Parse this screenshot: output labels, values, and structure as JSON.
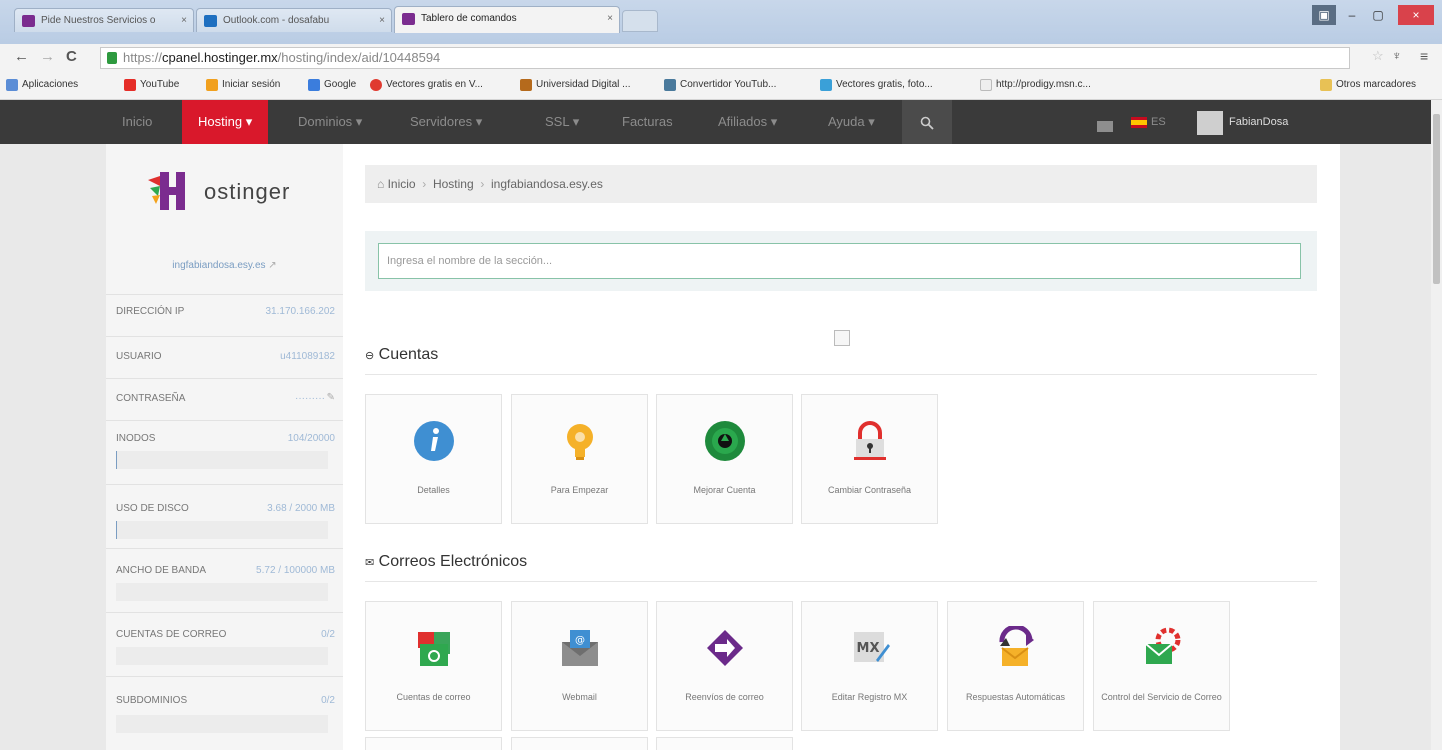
{
  "browser": {
    "tabs": [
      {
        "label": "Pide Nuestros Servicios o",
        "active": false
      },
      {
        "label": "Outlook.com - dosafabu",
        "active": false
      },
      {
        "label": "Tablero de comandos",
        "active": true
      }
    ],
    "url_scheme": "https://",
    "url_host": "cpanel.hostinger.mx",
    "url_path": "/hosting/index/aid/10448594",
    "bookmarks": [
      "Aplicaciones",
      "YouTube",
      "Iniciar sesión",
      "Google",
      "Vectores gratis en V...",
      "Universidad Digital ...",
      "Convertidor YouTub...",
      "Vectores gratis, foto...",
      "http://prodigy.msn.c...",
      "Otros marcadores"
    ]
  },
  "topnav": {
    "items": [
      "Inicio",
      "Hosting ▾",
      "Dominios ▾",
      "Servidores ▾",
      "SSL ▾",
      "Facturas",
      "Afiliados ▾",
      "Ayuda ▾"
    ],
    "search_icon": "search-icon",
    "language": "ES",
    "user": "FabianDosa"
  },
  "sidebar": {
    "logo_text": "ostinger",
    "site": "ingfabiandosa.esy.es",
    "rows": [
      {
        "label": "DIRECCIÓN IP",
        "value": "31.170.166.202"
      },
      {
        "label": "USUARIO",
        "value": "u411089182"
      },
      {
        "label": "CONTRASEÑA",
        "value": "·········"
      },
      {
        "label": "INODOS",
        "value": "104/20000",
        "usage": 0.005
      },
      {
        "label": "USO DE DISCO",
        "value": "3.68 / 2000 MB",
        "usage": 0.002
      },
      {
        "label": "ANCHO DE BANDA",
        "value": "5.72 / 100000 MB",
        "usage": 0.0001
      },
      {
        "label": "CUENTAS DE CORREO",
        "value": "0/2",
        "usage": 0
      },
      {
        "label": "SUBDOMINIOS",
        "value": "0/2",
        "usage": 0
      }
    ]
  },
  "main": {
    "breadcrumb": [
      "Inicio",
      "Hosting",
      "ingfabiandosa.esy.es"
    ],
    "search_placeholder": "Ingresa el nombre de la sección...",
    "sections": [
      {
        "title": "Cuentas",
        "tiles": [
          "Detalles",
          "Para Empezar",
          "Mejorar Cuenta",
          "Cambiar Contraseña"
        ]
      },
      {
        "title": "Correos Electrónicos",
        "tiles": [
          "Cuentas de correo",
          "Webmail",
          "Reenvíos de correo",
          "Editar Registro MX",
          "Respuestas Automáticas",
          "Control del Servicio de Correo"
        ]
      }
    ]
  },
  "colors": {
    "brand_red": "#d9182b",
    "nav_bg": "#3a3a3a",
    "link_blue": "#7a9dc2"
  }
}
